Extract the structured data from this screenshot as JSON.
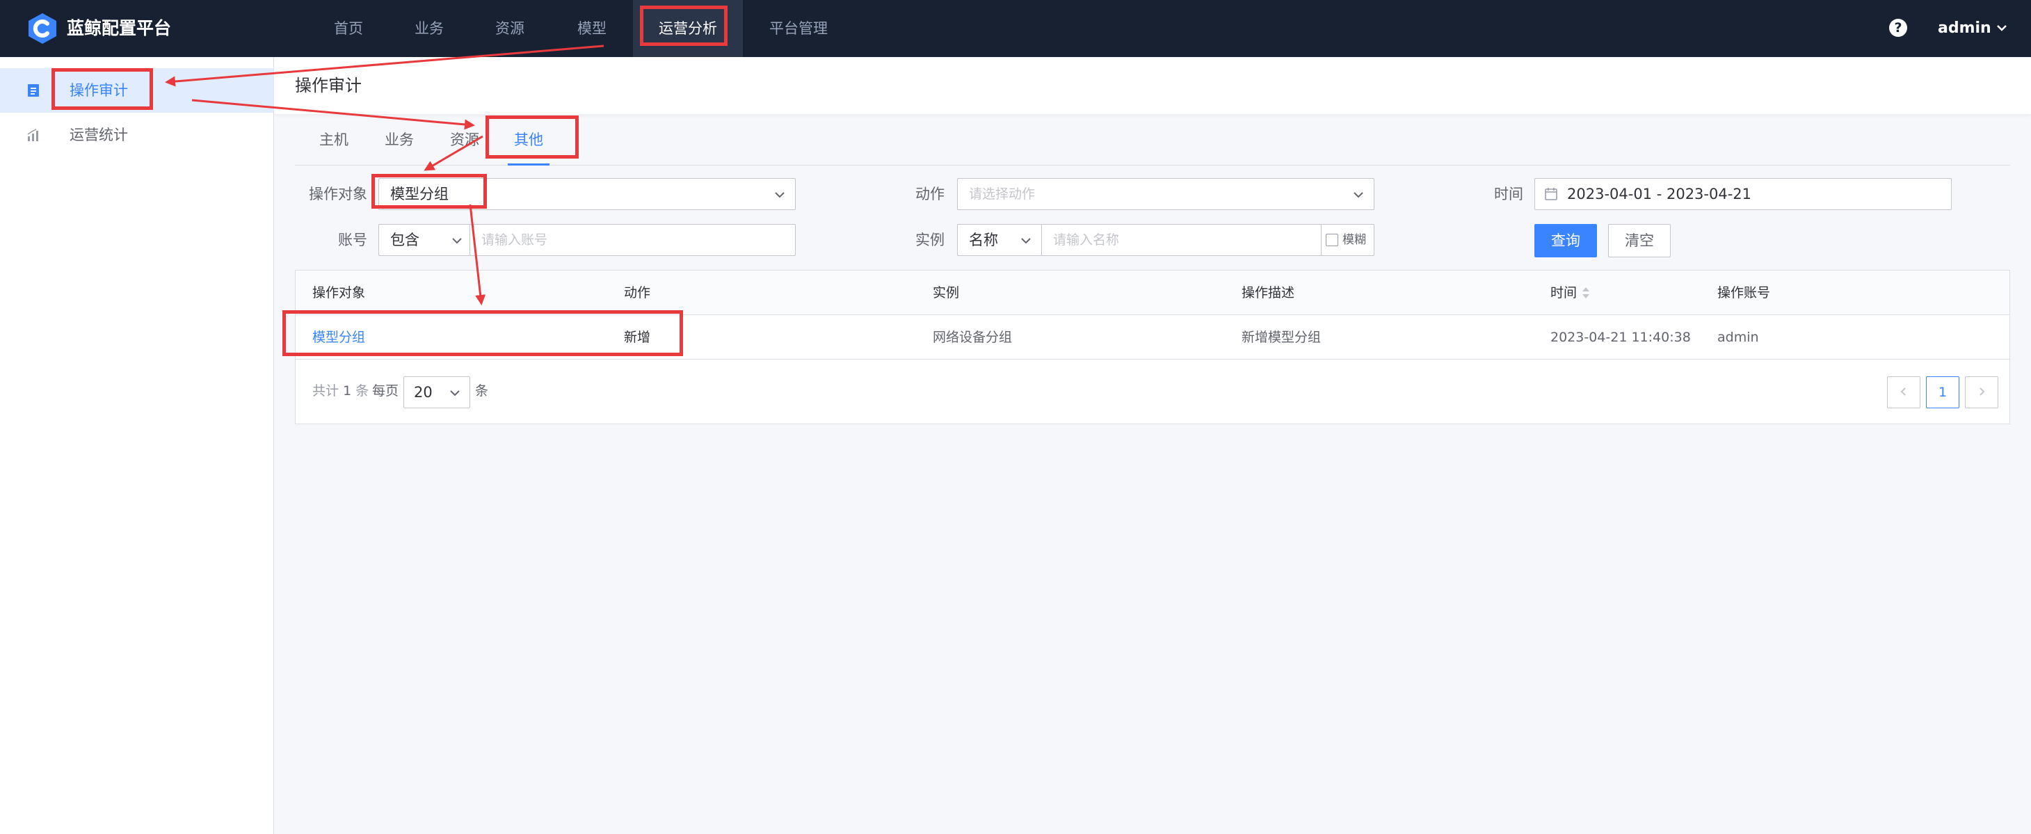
{
  "app": {
    "brand": "蓝鲸配置平台",
    "user": "admin"
  },
  "topnav": {
    "items": [
      {
        "label": "首页"
      },
      {
        "label": "业务"
      },
      {
        "label": "资源"
      },
      {
        "label": "模型"
      },
      {
        "label": "运营分析",
        "active": true
      },
      {
        "label": "平台管理"
      }
    ]
  },
  "sidebar": {
    "items": [
      {
        "label": "操作审计",
        "active": true
      },
      {
        "label": "运营统计"
      }
    ]
  },
  "page": {
    "title": "操作审计"
  },
  "tabs": [
    {
      "label": "主机"
    },
    {
      "label": "业务"
    },
    {
      "label": "资源"
    },
    {
      "label": "其他",
      "active": true
    }
  ],
  "filters": {
    "object_label": "操作对象",
    "object_value": "模型分组",
    "action_label": "动作",
    "action_placeholder": "请选择动作",
    "time_label": "时间",
    "time_value": "2023-04-01 - 2023-04-21",
    "account_label": "账号",
    "account_mode": "包含",
    "account_placeholder": "请输入账号",
    "instance_label": "实例",
    "instance_mode": "名称",
    "instance_placeholder": "请输入名称",
    "fuzzy_label": "模糊",
    "query_button": "查询",
    "clear_button": "清空"
  },
  "table": {
    "columns": [
      "操作对象",
      "动作",
      "实例",
      "操作描述",
      "时间",
      "操作账号"
    ],
    "rows": [
      {
        "object": "模型分组",
        "action": "新增",
        "instance": "网络设备分组",
        "description": "新增模型分组",
        "time": "2023-04-21 11:40:38",
        "account": "admin"
      }
    ]
  },
  "pagination": {
    "total_prefix": "共计",
    "total": "1",
    "total_suffix": "条",
    "per_page_label": "每页",
    "per_page": "20",
    "per_page_suffix": "条",
    "current_page": "1"
  },
  "colors": {
    "topbar": "#182132",
    "accent": "#3a84ff",
    "annotation": "#e8393c"
  }
}
